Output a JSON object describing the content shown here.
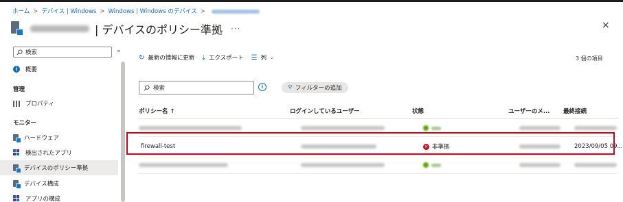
{
  "breadcrumb": {
    "items": [
      "ホーム",
      "デバイス | Windows",
      "Windows | Windows のデバイス"
    ],
    "separator": ">"
  },
  "header": {
    "title": "| デバイスのポリシー準拠",
    "more": "···",
    "close": "×"
  },
  "sidebar": {
    "search_placeholder": "検索",
    "collapse": "«",
    "overview": "概要",
    "section_manage": "管理",
    "properties": "プロパティ",
    "section_monitor": "モニター",
    "items": [
      "ハードウェア",
      "検出されたアプリ",
      "デバイスのポリシー準拠",
      "デバイス構成",
      "アプリの構成"
    ]
  },
  "toolbar": {
    "refresh": "最新の情報に更新",
    "export": "エクスポート",
    "columns": "列",
    "count": "3 個の項目"
  },
  "search": {
    "placeholder": "検索"
  },
  "filter": {
    "label": "フィルターの追加"
  },
  "table": {
    "columns": [
      "ポリシー名 ↑",
      "ログインしているユーザー",
      "状態",
      "ユーザーのメ...",
      "最終接続"
    ],
    "rows": [
      {
        "policy": "",
        "status": "",
        "last": ""
      },
      {
        "policy": "firewall-test",
        "status": "非準拠",
        "last": "2023/09/05 09..."
      },
      {
        "policy": "",
        "status": "",
        "last": ""
      }
    ]
  },
  "colors": {
    "accent": "#0f6cbd",
    "highlight": "#d0021b",
    "error": "#c50f1f",
    "success": "#57a300"
  }
}
